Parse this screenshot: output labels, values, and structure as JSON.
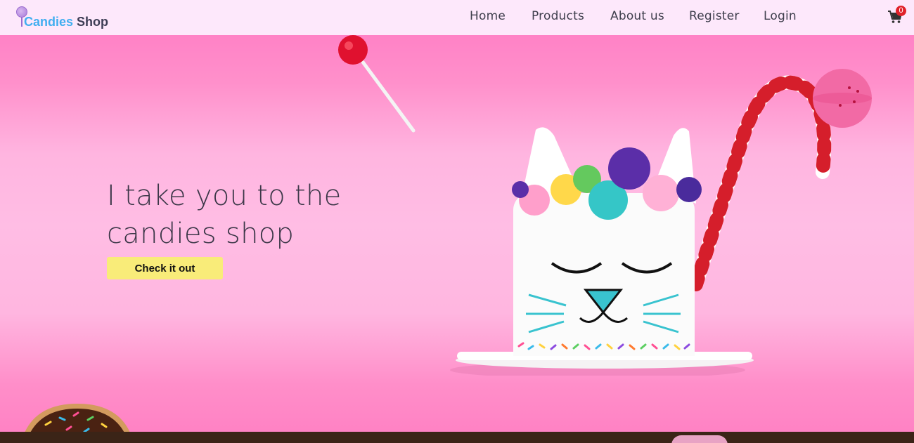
{
  "brand": {
    "part1": "Candies",
    "part2": " Shop"
  },
  "nav": {
    "links": [
      {
        "label": "Home"
      },
      {
        "label": "Products"
      },
      {
        "label": "About us"
      },
      {
        "label": "Register"
      },
      {
        "label": "Login"
      }
    ],
    "cart_count": "0",
    "cart_icon": "shopping-cart-icon"
  },
  "hero": {
    "headline_line1": "I take you to the",
    "headline_line2": "candies shop",
    "cta_label": "Check it out"
  },
  "colors": {
    "nav_bg": "#fde8fb",
    "hero_pink": "#ff8ec9",
    "cta_yellow": "#f9ec79",
    "brand_blue": "#41aef0",
    "badge_red": "#e0222a"
  }
}
